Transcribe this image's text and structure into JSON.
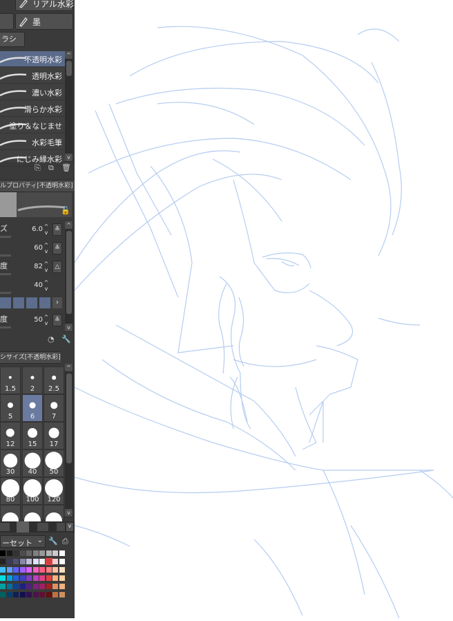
{
  "tool_buttons": [
    {
      "label": "リアル水彩",
      "icon": "brush-icon"
    },
    {
      "label": "墨",
      "icon": "brush-icon"
    }
  ],
  "subtool_tab": "ラシ",
  "brush_list": {
    "items": [
      {
        "label": "不透明水彩",
        "selected": true
      },
      {
        "label": "透明水彩",
        "selected": false
      },
      {
        "label": "濃い水彩",
        "selected": false
      },
      {
        "label": "滑らか水彩",
        "selected": false
      },
      {
        "label": "塗り＆なじませ",
        "selected": false
      },
      {
        "label": "水彩毛筆",
        "selected": false
      },
      {
        "label": "にじみ縁水彩",
        "selected": false
      }
    ]
  },
  "tool_property": {
    "header": "ルプロパティ[不透明水彩]",
    "rows": [
      {
        "label": "ズ",
        "value": "6.0",
        "action": "≚"
      },
      {
        "label": "",
        "value": "60",
        "action": "≚"
      },
      {
        "label": "度",
        "value": "82",
        "action": "△"
      },
      {
        "label": "",
        "value": "40",
        "action": ""
      },
      {
        "label": "度",
        "value": "50",
        "action": "≚"
      }
    ]
  },
  "brush_size": {
    "header": "シサイズ[不透明水彩]",
    "sizes": [
      "1.5",
      "2",
      "2.5",
      "5",
      "6",
      "7",
      "12",
      "15",
      "17",
      "30",
      "40",
      "50",
      "80",
      "100",
      "120"
    ],
    "selected": "6"
  },
  "color_set": {
    "label": "ーセット"
  },
  "colors": {
    "panel_bg": "#3a3a3a",
    "selection": "#5a6a8a",
    "sketch_line": "#a9c4ee"
  }
}
